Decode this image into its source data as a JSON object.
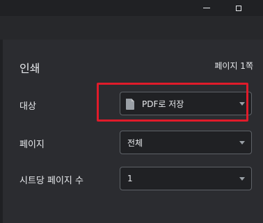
{
  "window": {
    "minimize_icon": "minimize-icon",
    "maximize_icon": "maximize-icon"
  },
  "print": {
    "title": "인쇄",
    "page_count": "페이지 1쪽",
    "destination": {
      "label": "대상",
      "value": "PDF로 저장",
      "icon": "document-icon"
    },
    "pages": {
      "label": "페이지",
      "value": "전체"
    },
    "pages_per_sheet": {
      "label": "시트당 페이지 수",
      "value": "1"
    }
  },
  "colors": {
    "highlight": "#e01b2a",
    "panel_bg": "#2b2c30",
    "text": "#e8eaed"
  }
}
